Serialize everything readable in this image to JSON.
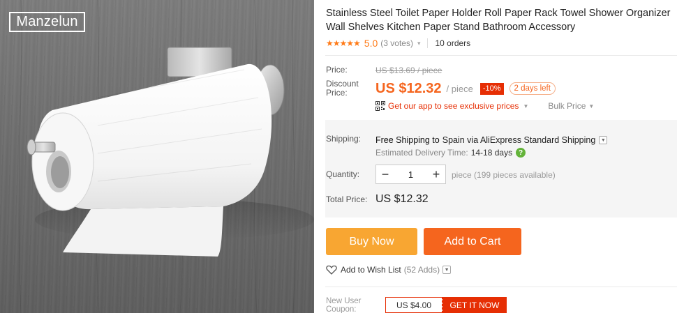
{
  "product_image": {
    "brand": "Manzelun"
  },
  "product": {
    "title": "Stainless Steel Toilet Paper Holder Roll Paper Rack Towel Shower Organizer Wall Shelves Kitchen Paper Stand Bathroom Accessory",
    "rating": {
      "stars": "★★★★★",
      "value": "5.0",
      "votes": "(3 votes)",
      "stars_value": 5.0
    },
    "orders": "10 orders"
  },
  "pricing": {
    "price_label": "Price:",
    "original_price": "US $13.69 / piece",
    "discount_label": "Discount Price:",
    "price": "US $12.32",
    "per_unit": "/ piece",
    "discount_badge": "-10%",
    "days_left": "2 days left",
    "app_promo": "Get our app to see exclusive prices",
    "bulk_price": "Bulk Price"
  },
  "shipping": {
    "label": "Shipping:",
    "free_shipping": "Free Shipping to",
    "destination": "Spain via AliExpress Standard Shipping",
    "delivery_label": "Estimated Delivery Time:",
    "delivery_days": "14-18 days"
  },
  "quantity": {
    "label": "Quantity:",
    "value": "1",
    "minus": "−",
    "plus": "+",
    "availability": "piece (199 pieces available)"
  },
  "total": {
    "label": "Total Price:",
    "value": "US $12.32"
  },
  "actions": {
    "buy_now": "Buy Now",
    "add_to_cart": "Add to Cart",
    "wishlist": "Add to Wish List",
    "wishlist_count": "(52 Adds)"
  },
  "coupon": {
    "label": "New User Coupon:",
    "value": "US $4.00",
    "cta": "GET IT NOW"
  },
  "colors": {
    "accent_orange": "#f5651e",
    "buy_now": "#f8a632",
    "discount_red": "#e62e04",
    "star": "#ff7a16"
  }
}
